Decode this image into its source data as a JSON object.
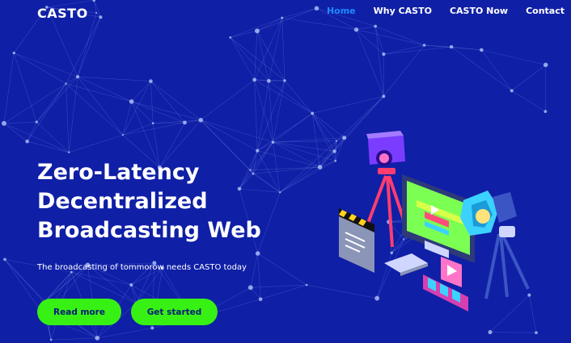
{
  "brand": {
    "logo": "CASTO"
  },
  "nav": {
    "items": [
      {
        "label": "Home",
        "active": true
      },
      {
        "label": "Why CASTO",
        "active": false
      },
      {
        "label": "CASTO Now",
        "active": false
      },
      {
        "label": "Contact",
        "active": false
      }
    ]
  },
  "hero": {
    "title_lines": [
      "Zero-Latency",
      "Decentralized",
      "Broadcasting Web"
    ],
    "subtitle": "The broadcasting of tommorow needs CASTO today",
    "buttons": {
      "read_more": "Read more",
      "get_started": "Get started"
    }
  },
  "colors": {
    "background": "#0f1fa6",
    "accent_green": "#38f114",
    "active_link": "#1f8bff"
  }
}
